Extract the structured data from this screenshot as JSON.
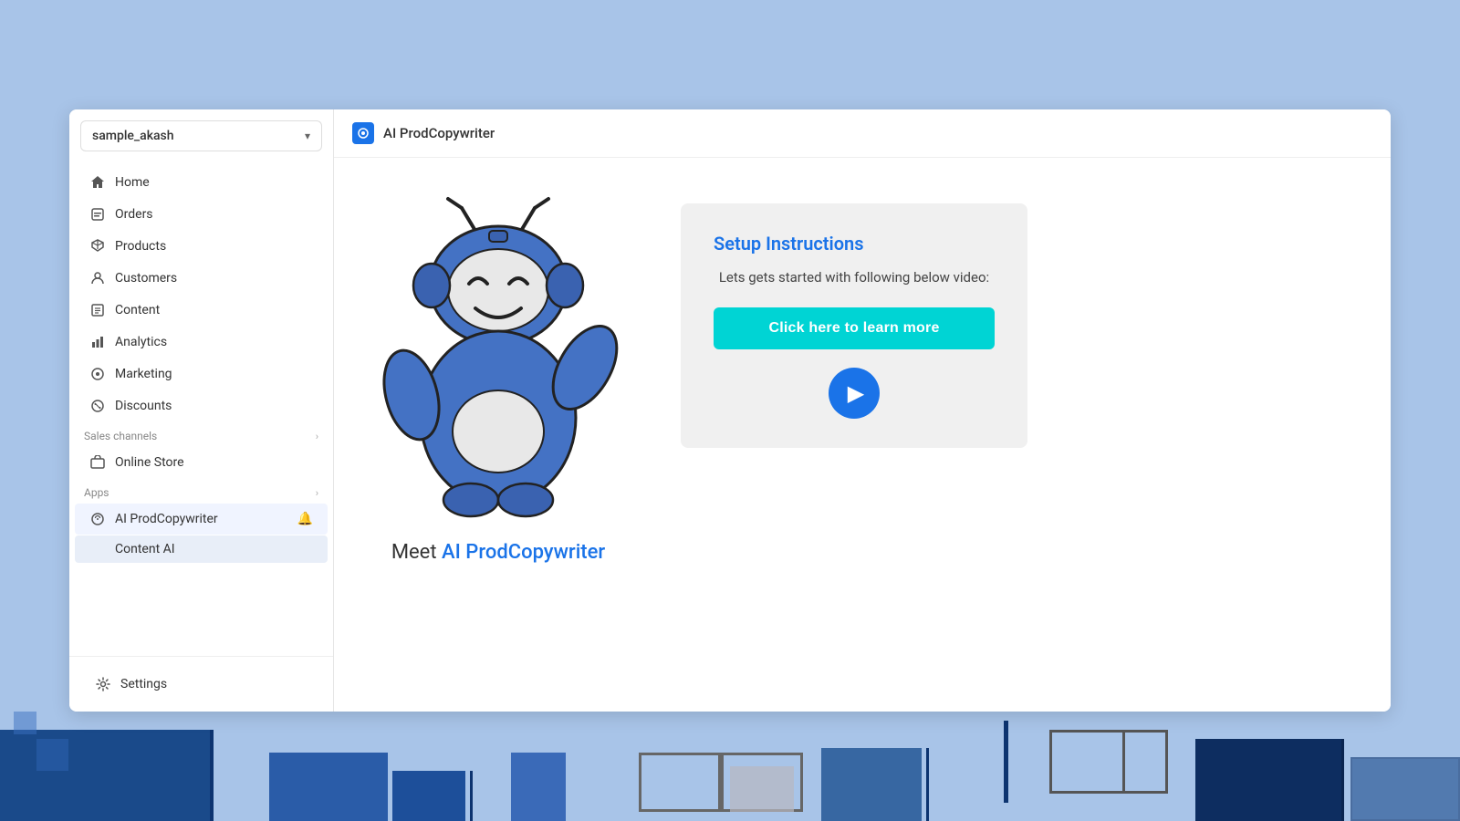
{
  "store": {
    "name": "sample_akash",
    "dropdown_label": "▾"
  },
  "nav": {
    "items": [
      {
        "id": "home",
        "label": "Home",
        "icon": "🏠"
      },
      {
        "id": "orders",
        "label": "Orders",
        "icon": "📦"
      },
      {
        "id": "products",
        "label": "Products",
        "icon": "🏷"
      },
      {
        "id": "customers",
        "label": "Customers",
        "icon": "👤"
      },
      {
        "id": "content",
        "label": "Content",
        "icon": "📄"
      },
      {
        "id": "analytics",
        "label": "Analytics",
        "icon": "📊"
      },
      {
        "id": "marketing",
        "label": "Marketing",
        "icon": "📣"
      },
      {
        "id": "discounts",
        "label": "Discounts",
        "icon": "🏷"
      }
    ],
    "sales_channels_label": "Sales channels",
    "sales_channels_items": [
      {
        "id": "online-store",
        "label": "Online Store",
        "icon": "🏪"
      }
    ],
    "apps_label": "Apps",
    "apps_items": [
      {
        "id": "ai-prodcopywriter",
        "label": "AI ProdCopywriter",
        "icon": "🤖"
      }
    ],
    "apps_sub_items": [
      {
        "id": "content-ai",
        "label": "Content AI"
      }
    ],
    "settings_label": "Settings"
  },
  "app": {
    "header_icon": "⚙",
    "title": "AI ProdCopywriter"
  },
  "setup": {
    "title": "Setup Instructions",
    "subtitle": "Lets gets started with following below video:",
    "learn_more_label": "Click here to learn more",
    "play_arrow": "▶"
  },
  "meet": {
    "prefix": "Meet ",
    "highlight": "AI ProdCopywriter"
  }
}
